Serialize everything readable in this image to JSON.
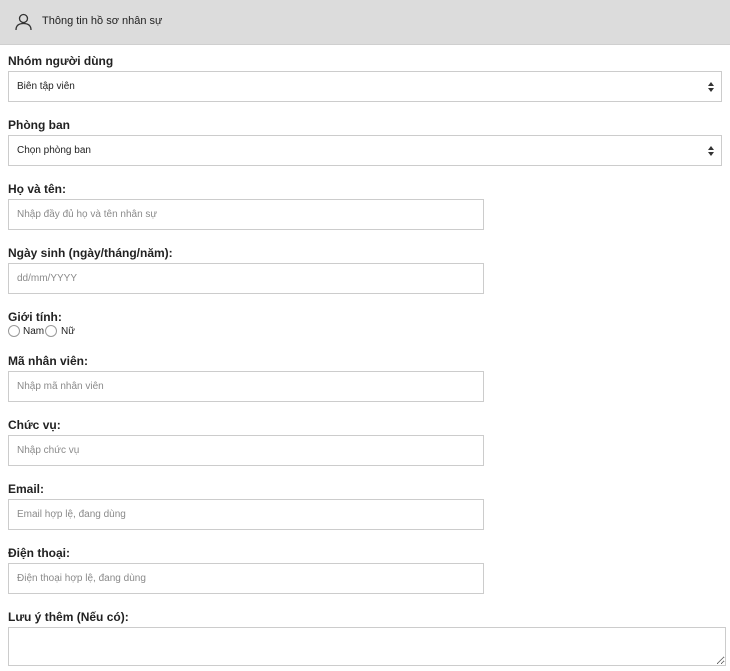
{
  "header": {
    "title": "Thông tin hồ sơ nhân sự",
    "icon": "user-icon"
  },
  "form": {
    "user_group": {
      "label": "Nhóm người dùng",
      "selected": "Biên tập viên"
    },
    "department": {
      "label": "Phòng ban",
      "selected": "Chọn phòng ban"
    },
    "full_name": {
      "label": "Họ và tên:",
      "value": "",
      "placeholder": "Nhập đầy đủ họ và tên nhân sự"
    },
    "birthday": {
      "label": "Ngày sinh (ngày/tháng/năm):",
      "value": "",
      "placeholder": "dd/mm/YYYY"
    },
    "gender": {
      "label": "Giới tính:",
      "options": [
        "Nam",
        "Nữ"
      ]
    },
    "employee_code": {
      "label": "Mã nhân viên:",
      "value": "",
      "placeholder": "Nhập mã nhân viên"
    },
    "position": {
      "label": "Chức vụ:",
      "value": "",
      "placeholder": "Nhập chức vụ"
    },
    "email": {
      "label": "Email:",
      "value": "",
      "placeholder": "Email hợp lệ, đang dùng"
    },
    "phone": {
      "label": "Điện thoại:",
      "value": "",
      "placeholder": "Điện thoại hợp lệ, đang dùng"
    },
    "notes": {
      "label": "Lưu ý thêm (Nếu có):",
      "value": ""
    }
  }
}
